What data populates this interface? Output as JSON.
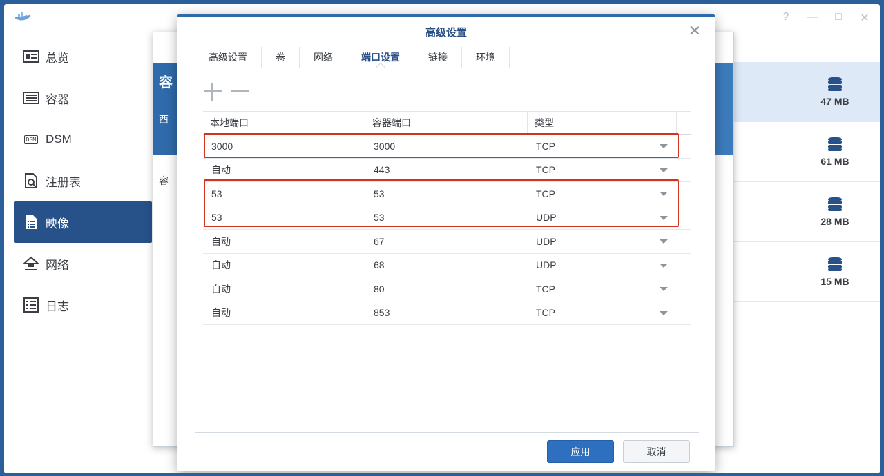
{
  "sidebar": {
    "items": [
      {
        "label": "总览",
        "icon": "overview-icon"
      },
      {
        "label": "容器",
        "icon": "container-icon"
      },
      {
        "label": "DSM",
        "icon": "dsm-icon",
        "badge": "DSM"
      },
      {
        "label": "注册表",
        "icon": "registry-icon"
      },
      {
        "label": "映像",
        "icon": "image-icon"
      },
      {
        "label": "网络",
        "icon": "network-icon"
      },
      {
        "label": "日志",
        "icon": "log-icon"
      }
    ]
  },
  "window_controls": {
    "help": "?",
    "minimize": "—",
    "maximize": "□",
    "close": "✕"
  },
  "image_list": {
    "rows": [
      {
        "size": "47 MB"
      },
      {
        "size": "61 MB"
      },
      {
        "size": "28 MB"
      },
      {
        "size": "15 MB"
      }
    ]
  },
  "bg_dialog": {
    "chars": [
      "容",
      "酉",
      "容"
    ]
  },
  "modal": {
    "title": "高级设置",
    "tabs": [
      "高级设置",
      "卷",
      "网络",
      "端口设置",
      "链接",
      "环境"
    ],
    "active_tab": "端口设置",
    "table": {
      "headers": [
        "本地端口",
        "容器端口",
        "类型"
      ],
      "rows": [
        {
          "local": "3000",
          "container": "3000",
          "type": "TCP"
        },
        {
          "local": "自动",
          "container": "443",
          "type": "TCP"
        },
        {
          "local": "53",
          "container": "53",
          "type": "TCP"
        },
        {
          "local": "53",
          "container": "53",
          "type": "UDP"
        },
        {
          "local": "自动",
          "container": "67",
          "type": "UDP"
        },
        {
          "local": "自动",
          "container": "68",
          "type": "UDP"
        },
        {
          "local": "自动",
          "container": "80",
          "type": "TCP"
        },
        {
          "local": "自动",
          "container": "853",
          "type": "TCP"
        }
      ]
    },
    "buttons": {
      "apply": "应用",
      "cancel": "取消"
    }
  },
  "colors": {
    "accent": "#2f6fbf",
    "highlight": "#d2341e",
    "sidebar_active": "#265189"
  }
}
